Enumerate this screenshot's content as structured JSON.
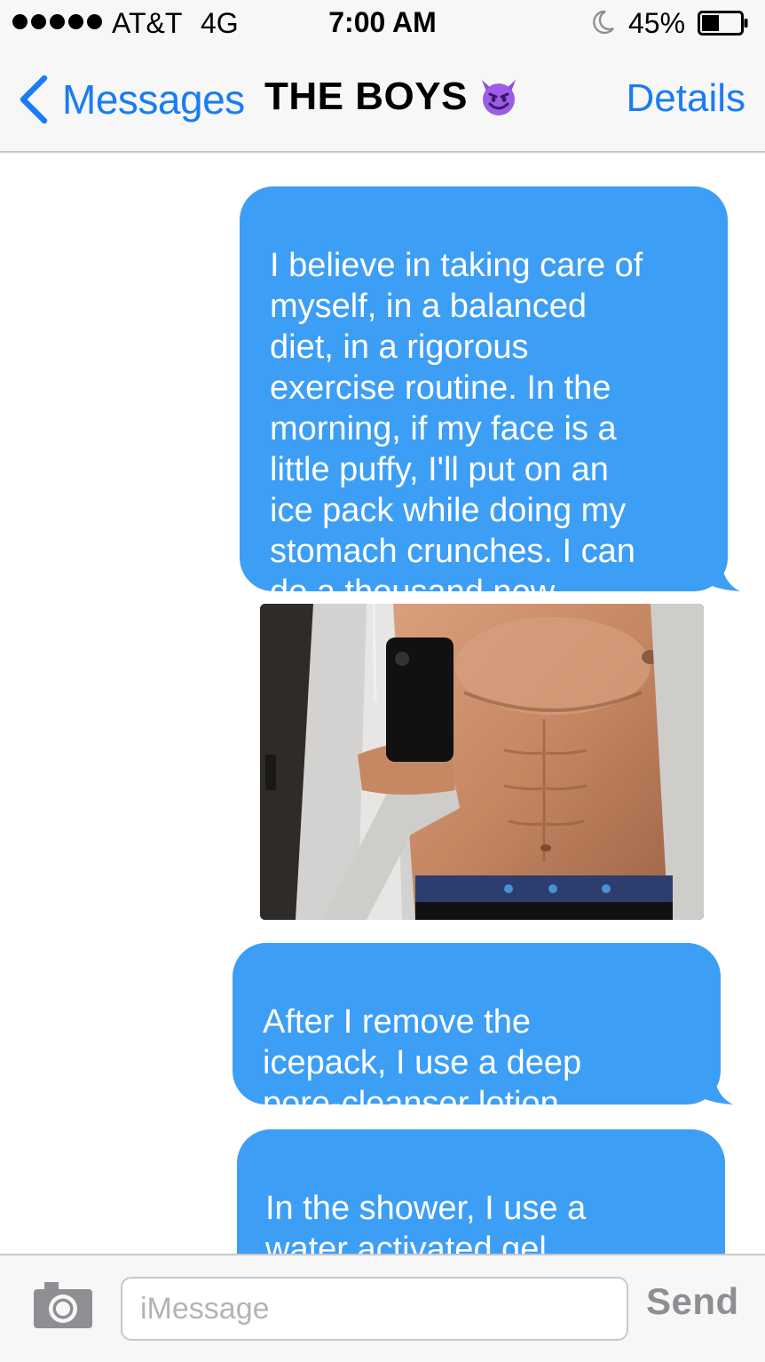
{
  "status_bar": {
    "signal_icon": "signal-dots-icon",
    "carrier": "AT&T",
    "network": "4G",
    "time": "7:00 AM",
    "do_not_disturb_icon": "moon-icon",
    "battery_percent": "45%",
    "battery_level": 0.45
  },
  "nav": {
    "back_label": "Messages",
    "title": "THE BOYS",
    "title_emoji": "smiling-devil-icon",
    "details_label": "Details"
  },
  "messages": [
    {
      "type": "text",
      "sender": "me",
      "text": "I believe in taking care of\nmyself, in a balanced\ndiet, in a rigorous\nexercise routine. In the\nmorning, if my face is a\nlittle puffy, I'll put on an\nice pack while doing my\nstomach crunches. I can\ndo a thousand now."
    },
    {
      "type": "image",
      "sender": "me",
      "image_icon": "mirror-selfie-photo"
    },
    {
      "type": "text",
      "sender": "me",
      "text": "After I remove the\nicepack, I use a deep\npore-cleanser lotion."
    },
    {
      "type": "text",
      "sender": "me",
      "text": "In the shower, I use a\nwater activated gel\ncleanser. Then a honey"
    }
  ],
  "input_bar": {
    "camera_icon": "camera-icon",
    "placeholder": "iMessage",
    "value": "",
    "send_label": "Send"
  },
  "colors": {
    "bubble_blue": "#3d9ef6",
    "ios_blue": "#1a7cf3",
    "bar_background": "#f7f7f7",
    "send_disabled": "#8e8e93"
  }
}
